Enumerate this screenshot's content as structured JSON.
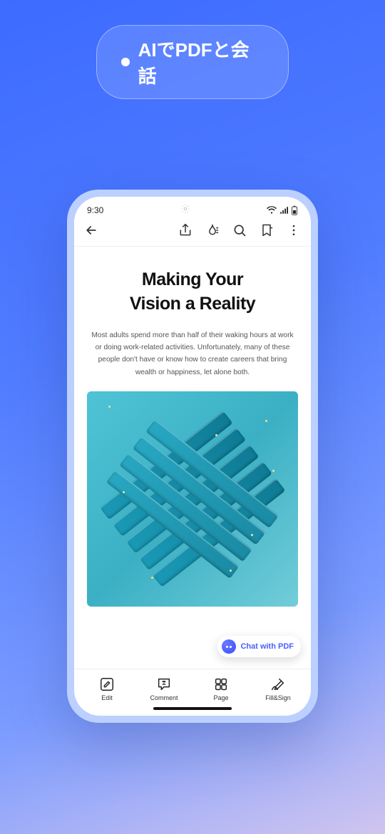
{
  "header": {
    "tagline": "AIでPDFと会話"
  },
  "status": {
    "time": "9:30"
  },
  "document": {
    "title_line1": "Making Your",
    "title_line2": "Vision a Reality",
    "body": "Most adults spend more than half of their waking hours at work or doing work-related activities. Unfortunately, many of these people don't have or know how to create careers that bring wealth or happiness, let alone both."
  },
  "chat": {
    "label": "Chat with PDF"
  },
  "bottom": {
    "edit": "Edit",
    "comment": "Comment",
    "page": "Page",
    "fillsign": "Fill&Sign"
  }
}
